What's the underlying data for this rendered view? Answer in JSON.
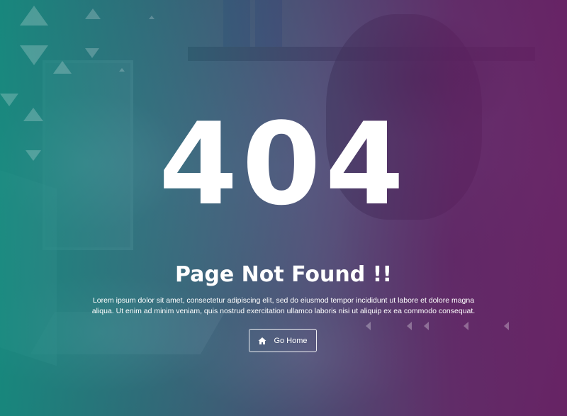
{
  "error": {
    "code": "404",
    "title": "Page Not Found !!",
    "description": "Lorem ipsum dolor sit amet, consectetur adipiscing elit, sed do eiusmod tempor incididunt ut labore et dolore magna aliqua. Ut enim ad minim veniam, quis nostrud exercitation ullamco laboris nisi ut aliquip ex ea commodo consequat."
  },
  "actions": {
    "home_label": "Go Home",
    "home_icon": "home-icon"
  },
  "theme": {
    "gradient_left": "#128a7e",
    "gradient_right": "#681e64",
    "text_color": "#ffffff"
  }
}
